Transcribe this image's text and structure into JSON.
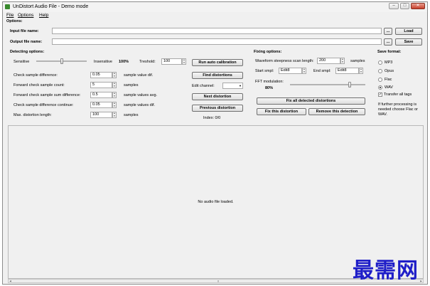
{
  "window": {
    "title": "UnDistort Audio File - Demo mode"
  },
  "menu": {
    "items": [
      "File",
      "Options",
      "Help"
    ]
  },
  "options": {
    "section_label": "Options:",
    "input_label": "Input file name:",
    "input_value": "",
    "browse_label": "...",
    "load_label": "Load",
    "output_label": "Output file name:",
    "output_value": "",
    "save_label": "Save"
  },
  "detecting": {
    "title": "Detecting options:",
    "sensitive_label": "Sensitive",
    "insensitive_label": "Insensitive",
    "sensitivity_percent": "100%",
    "sensitivity_slider_fraction": 0.5,
    "threshold_label": "Treshold:",
    "threshold_value": "100",
    "rows": [
      {
        "label": "Check sample difference:",
        "value": "0.05",
        "unit": "sample value dif."
      },
      {
        "label": "Forward check sample count:",
        "value": "5",
        "unit": "samples"
      },
      {
        "label": "Forward check sample sum difference:",
        "value": "0.5",
        "unit": "sample values avg."
      },
      {
        "label": "Check sample difference continue:",
        "value": "0.05",
        "unit": "sample values dif."
      },
      {
        "label": "Max. distortion length:",
        "value": "100",
        "unit": "samples"
      }
    ]
  },
  "actions": {
    "run_auto_calibration": "Run auto calibration",
    "find_distortions": "Find distortions",
    "edit_channel_label": "Edit channel:",
    "edit_channel_value": "",
    "next_distortion": "Next distortion",
    "previous_distortion": "Previous distortion",
    "index_text": "Index: 0/0"
  },
  "fixing": {
    "title": "Fixing options:",
    "scan_length_label": "Waveform steepness scan length:",
    "scan_length_value": "200",
    "scan_length_unit": "samples",
    "start_label": "Start smpl:",
    "start_value": "Edit8",
    "end_label": "End smpl:",
    "end_value": "Edit8",
    "fft_label": "FFT modulation:",
    "fft_percent": "80%",
    "fft_slider_fraction": 0.8,
    "fix_all_label": "Fix all detected distortions",
    "fix_this_label": "Fix this distortion",
    "remove_label": "Remove this detection"
  },
  "save_format": {
    "title": "Save format:",
    "options": [
      "MP3",
      "Opus",
      "Flac",
      "WAV"
    ],
    "selected": "WAV",
    "transfer_tags_label": "Transfer all tags",
    "transfer_tags_checked": true,
    "note": "If further processing is needed choose Flac or WAV."
  },
  "waveform": {
    "empty_message": "No audio file loaded."
  },
  "watermark": {
    "text": "最需网"
  }
}
